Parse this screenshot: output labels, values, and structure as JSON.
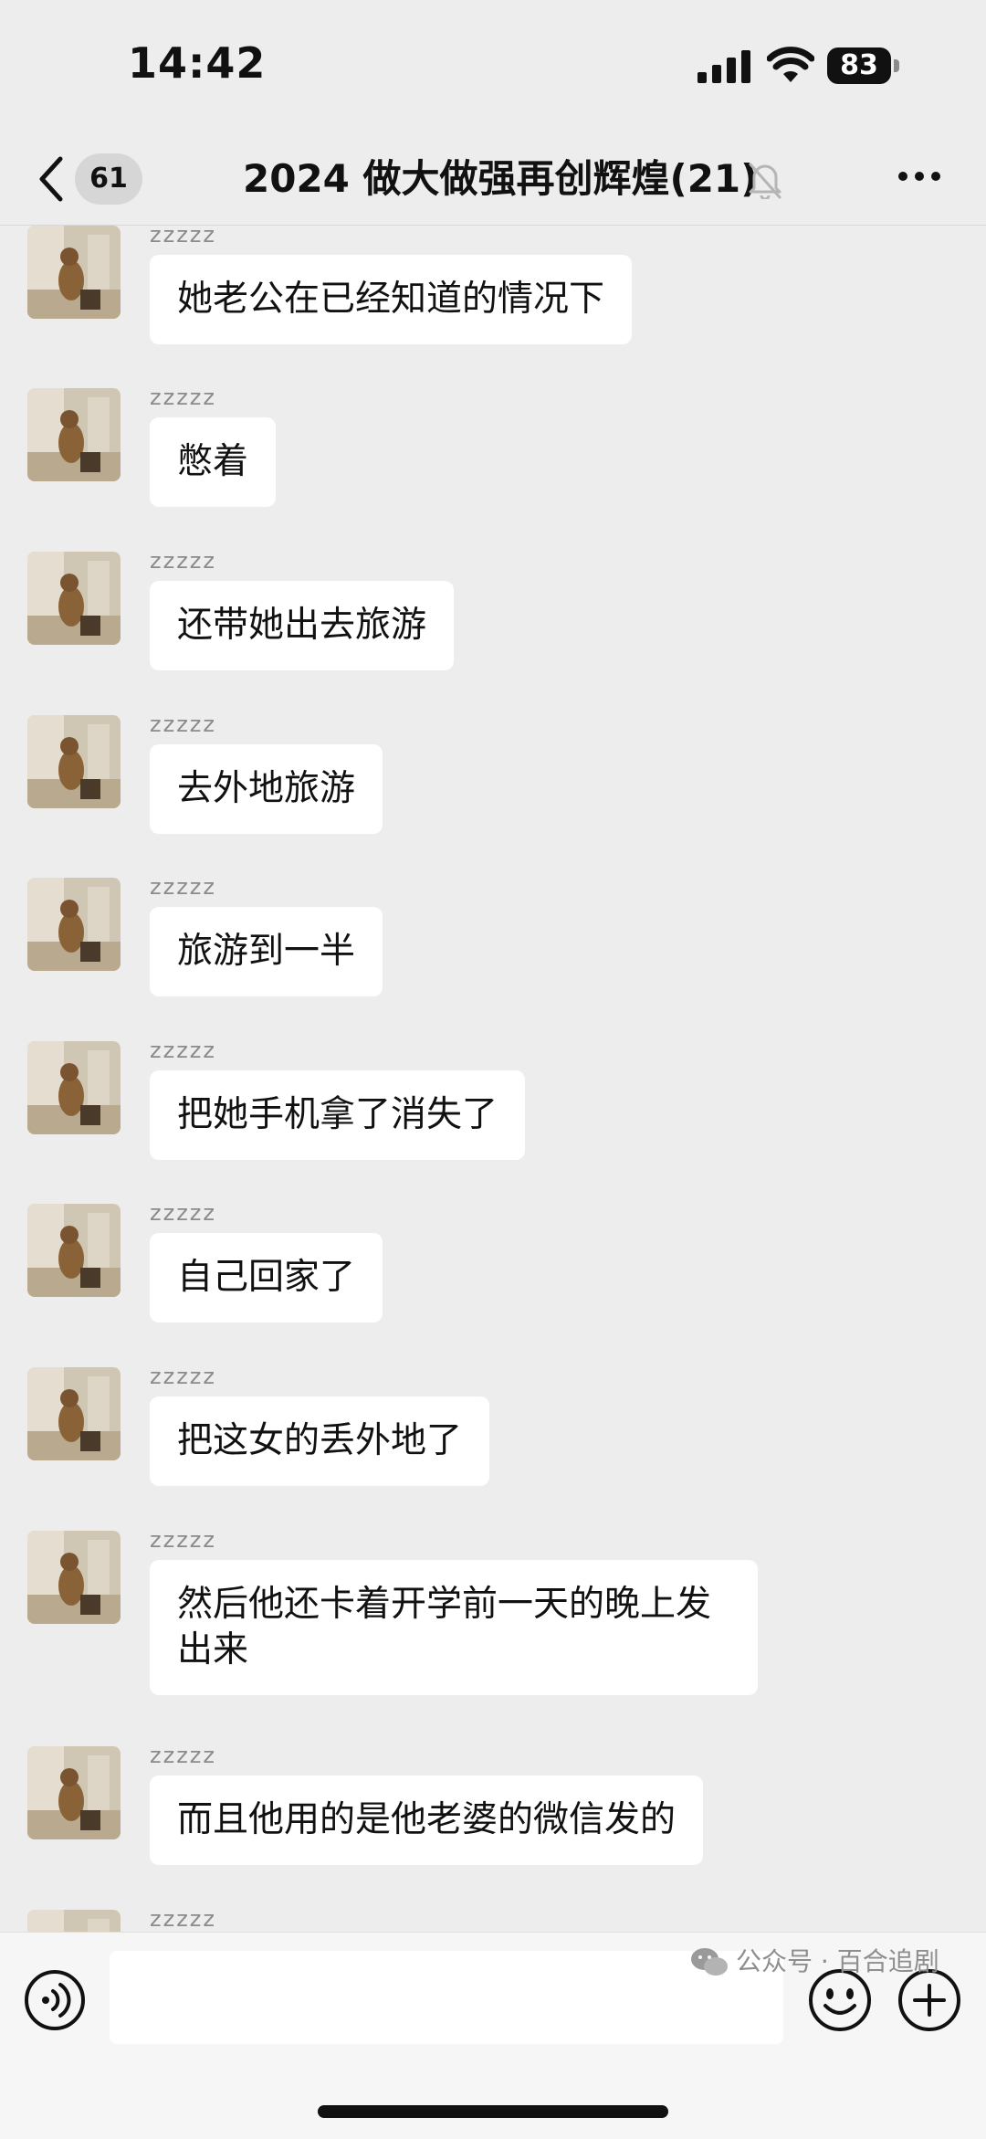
{
  "status_bar": {
    "time": "14:42",
    "battery_level": "83",
    "signal_icon": "cellular-signal-icon",
    "wifi_icon": "wifi-icon"
  },
  "nav": {
    "back_icon": "chevron-left-icon",
    "unread_count": "61",
    "title": "2024 做大做强再创辉煌(21)",
    "mute_icon": "bell-muted-icon",
    "more_icon": "more-dots-icon"
  },
  "messages": [
    {
      "sender": "zzzzz",
      "text": "她老公在已经知道的情况下"
    },
    {
      "sender": "zzzzz",
      "text": "憋着"
    },
    {
      "sender": "zzzzz",
      "text": "还带她出去旅游"
    },
    {
      "sender": "zzzzz",
      "text": "去外地旅游"
    },
    {
      "sender": "zzzzz",
      "text": "旅游到一半"
    },
    {
      "sender": "zzzzz",
      "text": "把她手机拿了消失了"
    },
    {
      "sender": "zzzzz",
      "text": "自己回家了"
    },
    {
      "sender": "zzzzz",
      "text": "把这女的丢外地了"
    },
    {
      "sender": "zzzzz",
      "text": "然后他还卡着开学前一天的晚上发出来"
    },
    {
      "sender": "zzzzz",
      "text": "而且他用的是他老婆的微信发的"
    },
    {
      "sender": "zzzzz",
      "text": ""
    }
  ],
  "input_bar": {
    "voice_icon": "voice-icon",
    "input_value": "",
    "emoji_icon": "emoji-icon",
    "plus_icon": "plus-icon"
  },
  "watermark": {
    "text": "公众号 · 百合追剧",
    "icon": "wechat-logo-icon"
  },
  "colors": {
    "background": "#ededed",
    "bubble": "#ffffff",
    "sender_name": "#8b8b8b",
    "text": "#111111"
  }
}
